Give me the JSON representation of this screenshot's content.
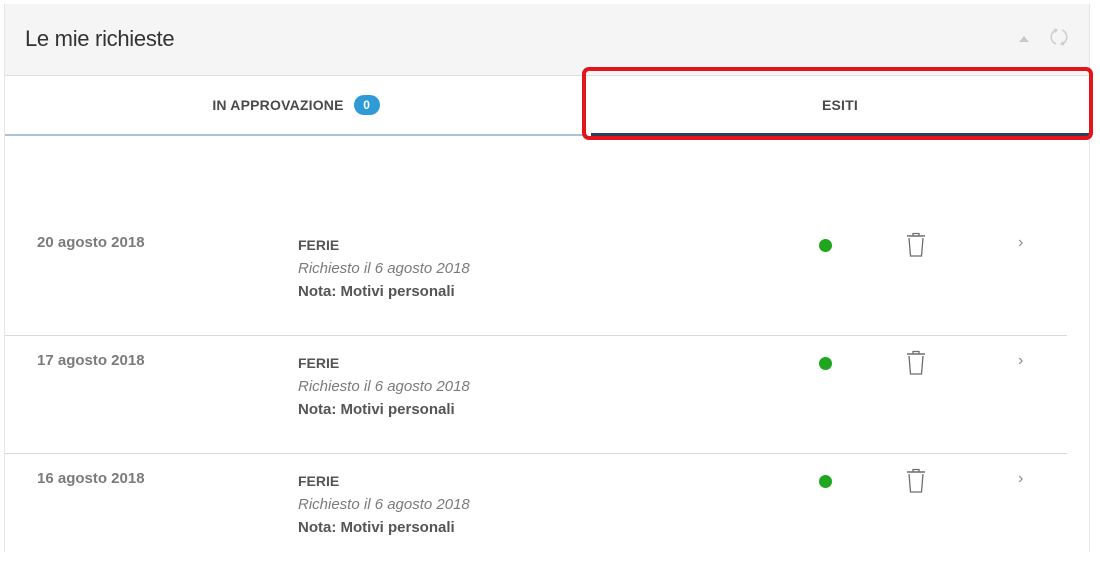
{
  "panel": {
    "title": "Le mie richieste"
  },
  "tabs": [
    {
      "label": "IN APPROVAZIONE",
      "badge": "0",
      "active": false
    },
    {
      "label": "ESITI",
      "active": true
    }
  ],
  "requests": [
    {
      "date": "20 agosto 2018",
      "type": "FERIE",
      "requested": "Richiesto il 6 agosto 2018",
      "note": "Nota: Motivi personali",
      "status_color": "#1ea61e"
    },
    {
      "date": "17 agosto 2018",
      "type": "FERIE",
      "requested": "Richiesto il 6 agosto 2018",
      "note": "Nota: Motivi personali",
      "status_color": "#1ea61e"
    },
    {
      "date": "16 agosto 2018",
      "type": "FERIE",
      "requested": "Richiesto il 6 agosto 2018",
      "note": "Nota: Motivi personali",
      "status_color": "#1ea61e"
    }
  ],
  "icons": {
    "collapse": "triangle-up-icon",
    "refresh": "refresh-icon",
    "delete": "trash-icon",
    "open": "chevron-right-icon"
  },
  "colors": {
    "accent": "#2e9bd6",
    "active_tab_underline": "#2c3e5c",
    "highlight": "#e3151a",
    "status_ok": "#1ea61e"
  }
}
